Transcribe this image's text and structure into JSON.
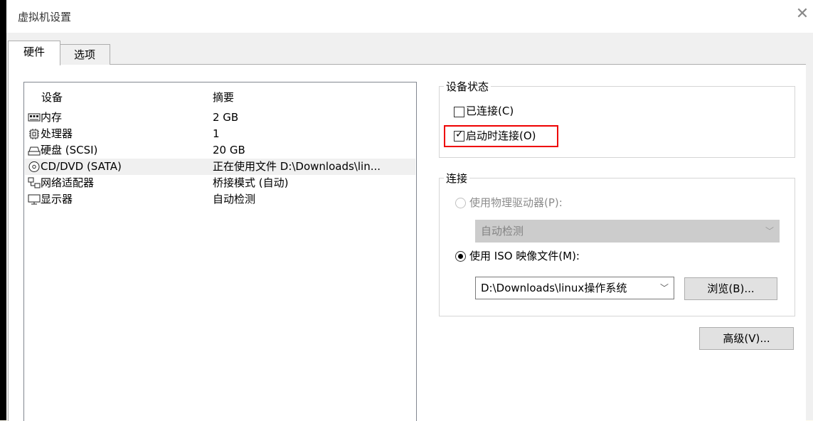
{
  "window": {
    "title": "虚拟机设置"
  },
  "tabs": [
    {
      "label": "硬件"
    },
    {
      "label": "选项"
    }
  ],
  "devices": {
    "header_device": "设备",
    "header_summary": "摘要",
    "rows": [
      {
        "device": "内存",
        "summary": "2 GB",
        "icon": "memory-icon"
      },
      {
        "device": "处理器",
        "summary": "1",
        "icon": "processor-icon"
      },
      {
        "device": "硬盘 (SCSI)",
        "summary": "20 GB",
        "icon": "hard-disk-icon"
      },
      {
        "device": "CD/DVD (SATA)",
        "summary": "正在使用文件 D:\\Downloads\\lin...",
        "icon": "cd-dvd-icon"
      },
      {
        "device": "网络适配器",
        "summary": "桥接模式 (自动)",
        "icon": "network-adapter-icon"
      },
      {
        "device": "显示器",
        "summary": "自动检测",
        "icon": "monitor-icon"
      }
    ]
  },
  "device_status": {
    "title": "设备状态",
    "connected_label": "已连接(C)",
    "connected_checked": false,
    "connect_at_power_on_label": "启动时连接(O)",
    "connect_at_power_on_checked": true
  },
  "connection": {
    "title": "连接",
    "physical_label": "使用物理驱动器(P):",
    "physical_value": "自动检测",
    "iso_label": "使用 ISO 映像文件(M):",
    "iso_value": "D:\\Downloads\\linux操作系统",
    "browse_label": "浏览(B)..."
  },
  "advanced_label": "高级(V)...",
  "colors": {
    "highlight": "#e00000",
    "disabled_field": "#cccccc"
  }
}
